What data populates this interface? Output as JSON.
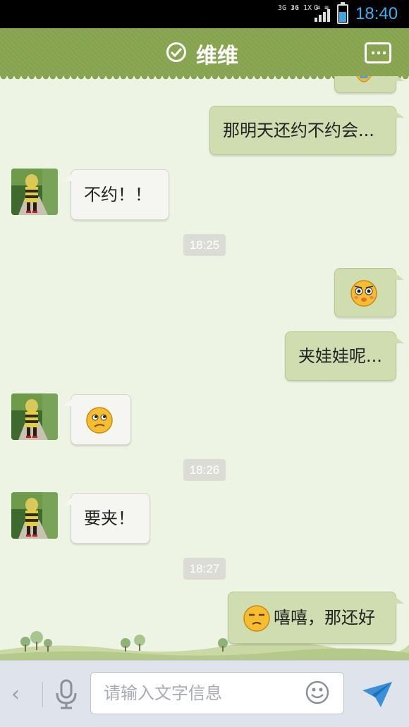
{
  "status_bar": {
    "net_1": "3G\n↓↑",
    "net_2": "3G 1X\n≡ ≡",
    "net_3": "G",
    "time": "18:40",
    "battery_color": "#3aa5de"
  },
  "header": {
    "title": "维维",
    "status_icon": "check-circle-icon",
    "menu_icon": "chat-menu-icon"
  },
  "messages": [
    {
      "side": "out",
      "type": "emoji",
      "emoji": "cut-off-emoji"
    },
    {
      "side": "out",
      "type": "text",
      "text": "那明天还约不约会..."
    },
    {
      "side": "in",
      "type": "text",
      "text": "不约！！"
    },
    {
      "type": "timestamp",
      "text": "18:25"
    },
    {
      "side": "out",
      "type": "emoji",
      "emoji": "pleading-face-emoji"
    },
    {
      "side": "out",
      "type": "text",
      "text": "夹娃娃呢..."
    },
    {
      "side": "in",
      "type": "emoji",
      "emoji": "confused-face-emoji"
    },
    {
      "type": "timestamp",
      "text": "18:26"
    },
    {
      "side": "in",
      "type": "text",
      "text": "要夹！"
    },
    {
      "type": "timestamp",
      "text": "18:27"
    },
    {
      "side": "out",
      "type": "text_with_emoji",
      "emoji": "smug-face-emoji",
      "text": "嘻嘻，那还好"
    }
  ],
  "input": {
    "placeholder": "请输入文字信息",
    "value": ""
  },
  "colors": {
    "header_bg": "#86a34e",
    "chat_bg": "#eef4e3",
    "outgoing_bubble": "#cfddb0",
    "incoming_bubble": "#f5f5f2",
    "send_icon": "#3a8fd8"
  }
}
